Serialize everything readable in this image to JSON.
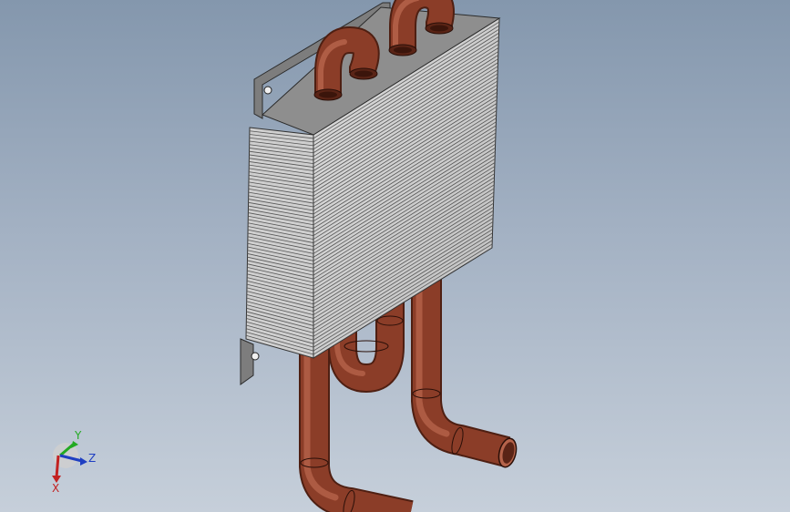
{
  "viewport": {
    "background_top": "#8497ad",
    "background_bottom": "#c6cfda"
  },
  "model": {
    "fin_color": "#d4d4d4",
    "fin_line_color": "#555555",
    "plate_color": "#8a8a8a",
    "pipe_color": "#8b3d28",
    "pipe_highlight": "#c06a4f",
    "pipe_shadow": "#5a2416"
  },
  "triad": {
    "y_label": "Y",
    "z_label": "Z",
    "x_label": "X",
    "y_color": "#22aa22",
    "z_color": "#1f3fc2",
    "x_color": "#c22222"
  }
}
